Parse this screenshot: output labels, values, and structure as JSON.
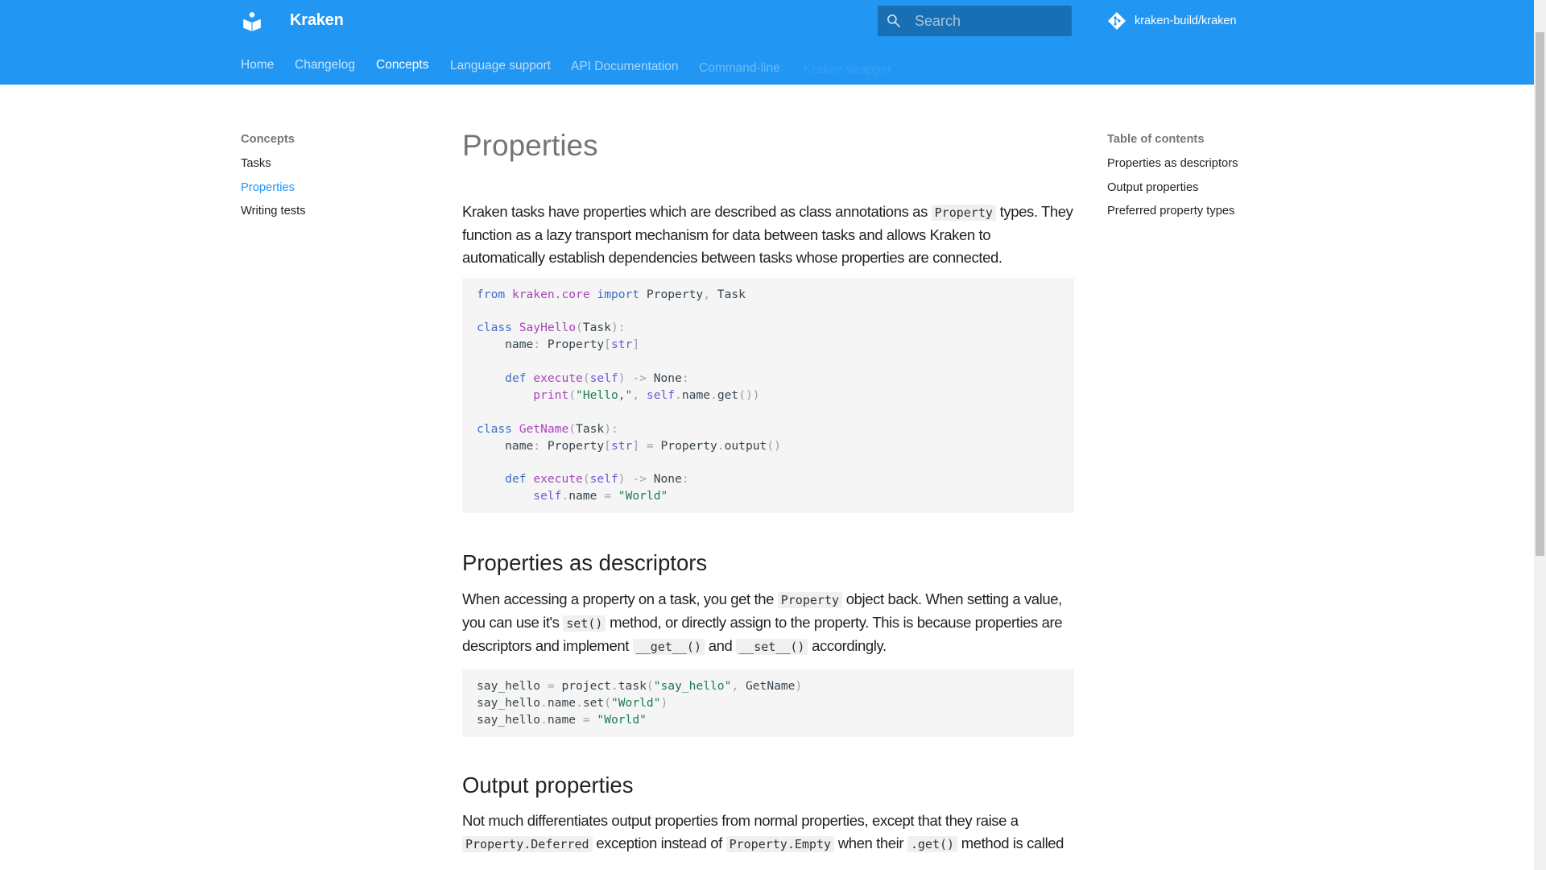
{
  "header": {
    "site_title": "Kraken",
    "search_placeholder": "Search",
    "repo": "kraken-build/kraken"
  },
  "tabs": [
    {
      "label": "Home"
    },
    {
      "label": "Changelog"
    },
    {
      "label": "Concepts"
    },
    {
      "label": "Language support"
    },
    {
      "label": "API Documentation"
    },
    {
      "label": "Command-line"
    },
    {
      "label": "Kraken wrapper"
    }
  ],
  "sidebar": {
    "title": "Concepts",
    "items": [
      {
        "label": "Tasks"
      },
      {
        "label": "Properties"
      },
      {
        "label": "Writing tests"
      }
    ]
  },
  "toc": {
    "title": "Table of contents",
    "items": [
      {
        "label": "Properties as descriptors"
      },
      {
        "label": "Output properties"
      },
      {
        "label": "Preferred property types"
      }
    ]
  },
  "content": {
    "title": "Properties",
    "intro": [
      "Kraken tasks have properties which are described as class annotations as ",
      "Property",
      " types. They function as a lazy transport mechanism for data between tasks and allows Kraken to automatically establish dependencies between tasks whose properties are connected."
    ],
    "code1": [
      [
        [
          "k",
          "from"
        ],
        [
          "",
          "",
          " "
        ],
        [
          "n",
          "kraken.core"
        ],
        [
          "",
          " "
        ],
        [
          "k",
          "import"
        ],
        [
          "",
          " Property"
        ],
        [
          "p",
          ","
        ],
        [
          "",
          " Task"
        ]
      ],
      [],
      [
        [
          "k",
          "class"
        ],
        [
          "",
          " "
        ],
        [
          "n",
          "SayHello"
        ],
        [
          "p",
          "("
        ],
        [
          "",
          "Task"
        ],
        [
          "p",
          "):"
        ]
      ],
      [
        [
          "",
          "    name"
        ],
        [
          "p",
          ":"
        ],
        [
          "",
          " Property"
        ],
        [
          "p",
          "["
        ],
        [
          "b",
          "str"
        ],
        [
          "p",
          "]"
        ]
      ],
      [],
      [
        [
          "",
          "    "
        ],
        [
          "k",
          "def"
        ],
        [
          "",
          " "
        ],
        [
          "n",
          "execute"
        ],
        [
          "p",
          "("
        ],
        [
          "b",
          "self"
        ],
        [
          "p",
          ")"
        ],
        [
          "",
          " "
        ],
        [
          "p",
          "->"
        ],
        [
          "",
          " None"
        ],
        [
          "p",
          ":"
        ]
      ],
      [
        [
          "",
          "        "
        ],
        [
          "n",
          "print"
        ],
        [
          "p",
          "("
        ],
        [
          "s",
          "\"Hello,\""
        ],
        [
          "p",
          ","
        ],
        [
          "",
          " "
        ],
        [
          "b",
          "self"
        ],
        [
          "p",
          "."
        ],
        [
          "",
          "name"
        ],
        [
          "p",
          "."
        ],
        [
          "",
          "get"
        ],
        [
          "p",
          "())"
        ]
      ],
      [],
      [
        [
          "k",
          "class"
        ],
        [
          "",
          " "
        ],
        [
          "n",
          "GetName"
        ],
        [
          "p",
          "("
        ],
        [
          "",
          "Task"
        ],
        [
          "p",
          "):"
        ]
      ],
      [
        [
          "",
          "    name"
        ],
        [
          "p",
          ":"
        ],
        [
          "",
          " Property"
        ],
        [
          "p",
          "["
        ],
        [
          "b",
          "str"
        ],
        [
          "p",
          "]"
        ],
        [
          "",
          " "
        ],
        [
          "p",
          "="
        ],
        [
          "",
          " Property"
        ],
        [
          "p",
          "."
        ],
        [
          "",
          "output"
        ],
        [
          "p",
          "()"
        ]
      ],
      [],
      [
        [
          "",
          "    "
        ],
        [
          "k",
          "def"
        ],
        [
          "",
          " "
        ],
        [
          "n",
          "execute"
        ],
        [
          "p",
          "("
        ],
        [
          "b",
          "self"
        ],
        [
          "p",
          ")"
        ],
        [
          "",
          " "
        ],
        [
          "p",
          "->"
        ],
        [
          "",
          " None"
        ],
        [
          "p",
          ":"
        ]
      ],
      [
        [
          "",
          "        "
        ],
        [
          "b",
          "self"
        ],
        [
          "p",
          "."
        ],
        [
          "",
          "name "
        ],
        [
          "p",
          "="
        ],
        [
          "",
          " "
        ],
        [
          "s",
          "\"World\""
        ]
      ]
    ],
    "h2_descriptors": "Properties as descriptors",
    "descriptors_p": [
      "When accessing a property on a task, you get the ",
      "Property",
      " object back. When setting a value, you can use it's ",
      "set()",
      " method, or directly assign to the property. This is because properties are descriptors and implement ",
      "__get__()",
      " and ",
      "__set__()",
      " accordingly."
    ],
    "code2": [
      [
        [
          "",
          "say_hello "
        ],
        [
          "p",
          "="
        ],
        [
          "",
          " project"
        ],
        [
          "p",
          "."
        ],
        [
          "",
          "task"
        ],
        [
          "p",
          "("
        ],
        [
          "s",
          "\"say_hello\""
        ],
        [
          "p",
          ","
        ],
        [
          "",
          " GetName"
        ],
        [
          "p",
          ")"
        ]
      ],
      [
        [
          "",
          "say_hello"
        ],
        [
          "p",
          "."
        ],
        [
          "",
          "name"
        ],
        [
          "p",
          "."
        ],
        [
          "",
          "set"
        ],
        [
          "p",
          "("
        ],
        [
          "s",
          "\"World\""
        ],
        [
          "p",
          ")"
        ]
      ],
      [
        [
          "",
          "say_hello"
        ],
        [
          "p",
          "."
        ],
        [
          "",
          "name "
        ],
        [
          "p",
          "="
        ],
        [
          "",
          " "
        ],
        [
          "s",
          "\"World\""
        ]
      ]
    ],
    "h2_output": "Output properties",
    "output_p": [
      "Not much differentiates output properties from normal properties, except that they raise a ",
      "Property.Deferred",
      " exception instead of ",
      "Property.Empty",
      " when their ",
      ".get()",
      " method is called"
    ]
  },
  "colors": {
    "primary": "#2196f3",
    "keyword": "#3f6ec6",
    "name": "#a846b9",
    "string": "#1c7d4d",
    "builtin": "#6e59d9"
  }
}
